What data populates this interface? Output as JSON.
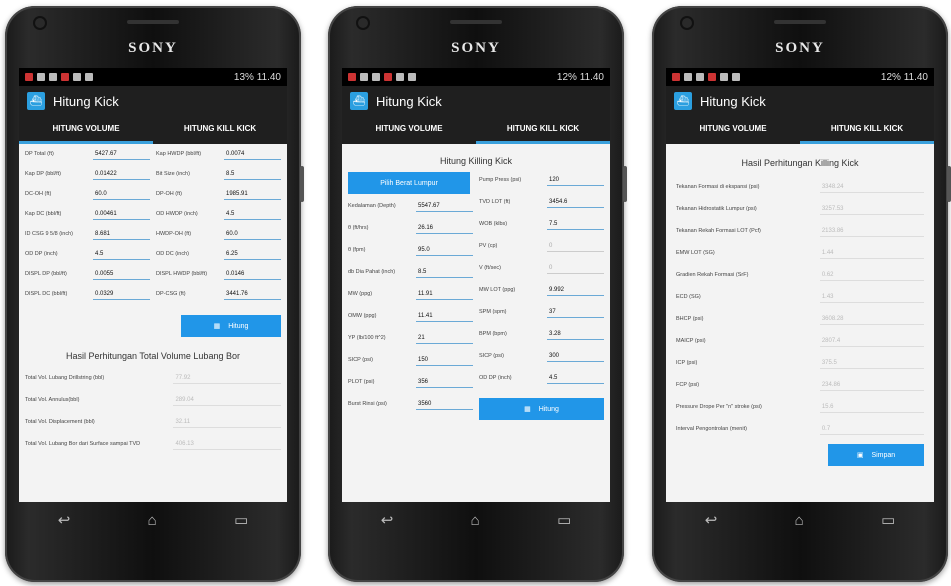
{
  "phones": [
    {
      "brand": "SONY",
      "status": {
        "right": "13% 11.40"
      },
      "app_title": "Hitung Kick",
      "tabs": [
        "HITUNG VOLUME",
        "HITUNG KILL KICK"
      ],
      "active_tab": 0,
      "fields": [
        {
          "label": "DP Total (ft)",
          "value": "5427.67"
        },
        {
          "label": "Kap HWDP (bbl/ft)",
          "value": "0.0074"
        },
        {
          "label": "Kap DP (bbl/ft)",
          "value": "0.01422"
        },
        {
          "label": "Bit Size (inch)",
          "value": "8.5"
        },
        {
          "label": "DC-OH (ft)",
          "value": "60.0"
        },
        {
          "label": "DP-OH (ft)",
          "value": "1985.91"
        },
        {
          "label": "Kap DC (bbl/ft)",
          "value": "0.00461"
        },
        {
          "label": "OD HWDP (inch)",
          "value": "4.5"
        },
        {
          "label": "ID CSG 9 5/8 (inch)",
          "value": "8.681"
        },
        {
          "label": "HWDP-OH (ft)",
          "value": "60.0"
        },
        {
          "label": "OD DP (inch)",
          "value": "4.5"
        },
        {
          "label": "OD DC (inch)",
          "value": "6.25"
        },
        {
          "label": "DISPL DP (bbl/ft)",
          "value": "0.0055"
        },
        {
          "label": "DISPL HWDP (bbl/ft)",
          "value": "0.0146"
        },
        {
          "label": "DISPL DC (bbl/ft)",
          "value": "0.0329"
        },
        {
          "label": "DP-CSG (ft)",
          "value": "3441.76"
        }
      ],
      "button": "Hitung",
      "result_title": "Hasil Perhitungan Total Volume Lubang Bor",
      "results": [
        {
          "label": "Total Vol. Lubang Drillstring (bbl)",
          "value": "77.92"
        },
        {
          "label": "Total Vol. Annulus(bbl)",
          "value": "289.04"
        },
        {
          "label": "Total Vol. Displacement (bbl)",
          "value": "32.11"
        },
        {
          "label": "Total Vol. Lubang Bor dari Surface sampai TVD",
          "value": "406.13"
        }
      ]
    },
    {
      "brand": "SONY",
      "status": {
        "right": "12% 11.40"
      },
      "app_title": "Hitung Kick",
      "tabs": [
        "HITUNG VOLUME",
        "HITUNG KILL KICK"
      ],
      "active_tab": 1,
      "heading": "Hitung Killing Kick",
      "pick_button": "Pilih Berat Lumpur",
      "left_fields": [
        {
          "label": "Kedalaman (Depth)",
          "value": "5547.67"
        },
        {
          "label": "θ (ft/hrs)",
          "value": "26.16"
        },
        {
          "label": "θ (fpm)",
          "value": "95.0"
        },
        {
          "label": "db Dia Pahat (inch)",
          "value": "8.5"
        },
        {
          "label": "MW (ppg)",
          "value": "11.91"
        },
        {
          "label": "OMW (ppg)",
          "value": "11.41"
        },
        {
          "label": "YP (lb/100 ft^2)",
          "value": "21"
        },
        {
          "label": "SICP (psi)",
          "value": "150"
        },
        {
          "label": "PLOT (psi)",
          "value": "356"
        },
        {
          "label": "Burst Rinsi (psi)",
          "value": "3560"
        }
      ],
      "right_fields": [
        {
          "label": "Pump Press (psi)",
          "value": "120"
        },
        {
          "label": "TVD LOT (ft)",
          "value": "3454.6"
        },
        {
          "label": "WOB (klbs)",
          "value": "7.5"
        },
        {
          "label": "PV (cp)",
          "value": "0"
        },
        {
          "label": "V (ft/sec)",
          "value": "0"
        },
        {
          "label": "MW LOT (ppg)",
          "value": "9.992"
        },
        {
          "label": "SPM (spm)",
          "value": "37"
        },
        {
          "label": "BPM (bpm)",
          "value": "3.28"
        },
        {
          "label": "SICP (psi)",
          "value": "300"
        },
        {
          "label": "OD DP (inch)",
          "value": "4.5"
        }
      ],
      "button": "Hitung"
    },
    {
      "brand": "SONY",
      "status": {
        "right": "12% 11.40"
      },
      "app_title": "Hitung Kick",
      "tabs": [
        "HITUNG VOLUME",
        "HITUNG KILL KICK"
      ],
      "active_tab": 1,
      "result_title": "Hasil Perhitungan Killing Kick",
      "results": [
        {
          "label": "Tekanan Formasi di ekspansi (psi)",
          "value": "3348.24"
        },
        {
          "label": "Tekanan Hidrostatik Lumpur (psi)",
          "value": "3257.53"
        },
        {
          "label": "Tekanan Rekah Formasi LOT (Pcf)",
          "value": "2133.86"
        },
        {
          "label": "EMW LOT (SG)",
          "value": "1.44"
        },
        {
          "label": "Gradien Rekah Formasi (SrF)",
          "value": "0.62"
        },
        {
          "label": "ECD (SG)",
          "value": "1.43"
        },
        {
          "label": "BHCP (psi)",
          "value": "3608.28"
        },
        {
          "label": "MAICP (psi)",
          "value": "2807.4"
        },
        {
          "label": "ICP (psi)",
          "value": "375.5"
        },
        {
          "label": "FCP (psi)",
          "value": "234.86"
        },
        {
          "label": "Pressure Drope Per \"n\" stroke (psi)",
          "value": "15.6"
        },
        {
          "label": "Interval Pengontrolan (menit)",
          "value": "0.7"
        }
      ],
      "button": "Simpan"
    }
  ]
}
